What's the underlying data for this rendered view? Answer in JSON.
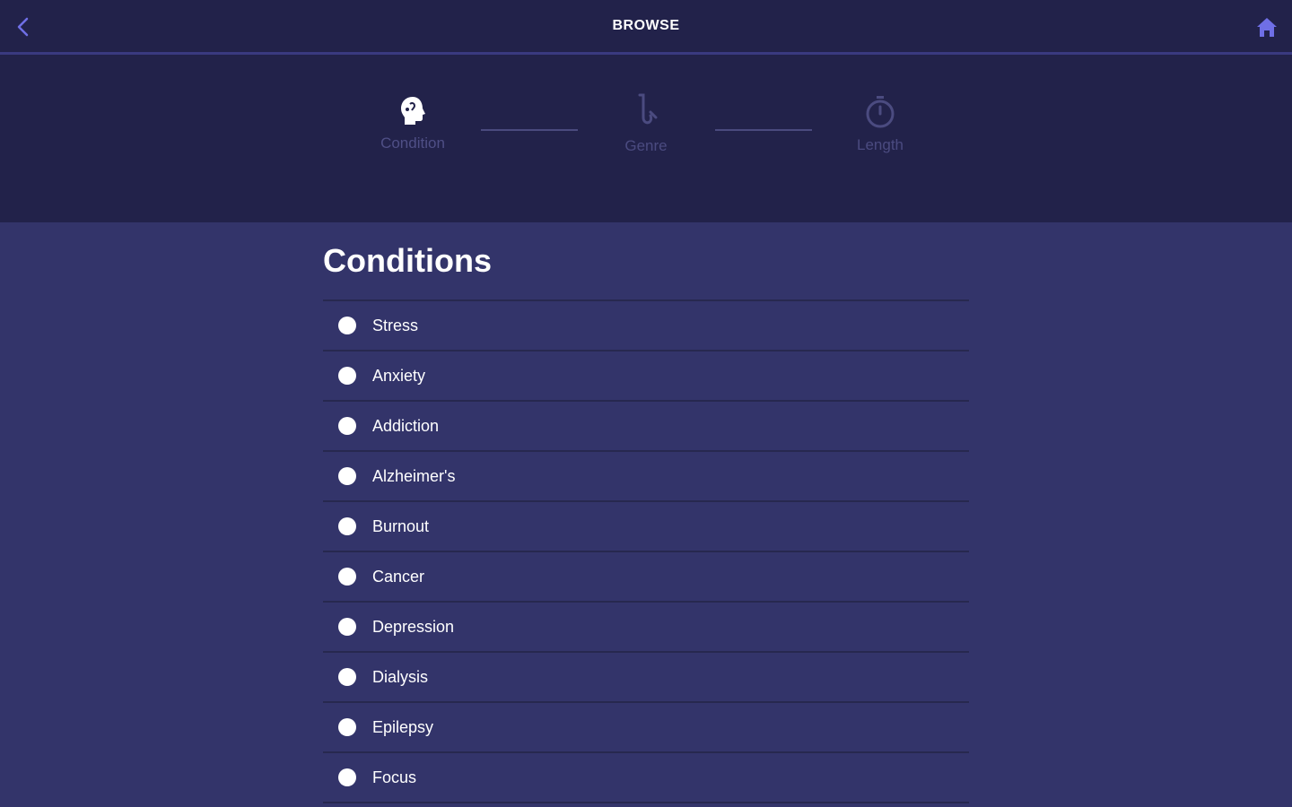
{
  "header": {
    "title": "BROWSE",
    "back_icon": "chevron-left-icon",
    "home_icon": "home-icon",
    "accent_color": "#6f6fe6"
  },
  "steps": [
    {
      "label": "Condition",
      "icon": "head-icon",
      "active": true
    },
    {
      "label": "Genre",
      "icon": "saxophone-icon",
      "active": false
    },
    {
      "label": "Length",
      "icon": "stopwatch-icon",
      "active": false
    }
  ],
  "section": {
    "title": "Conditions",
    "items": [
      {
        "label": "Stress"
      },
      {
        "label": "Anxiety"
      },
      {
        "label": "Addiction"
      },
      {
        "label": "Alzheimer's"
      },
      {
        "label": "Burnout"
      },
      {
        "label": "Cancer"
      },
      {
        "label": "Depression"
      },
      {
        "label": "Dialysis"
      },
      {
        "label": "Epilepsy"
      },
      {
        "label": "Focus"
      }
    ]
  }
}
